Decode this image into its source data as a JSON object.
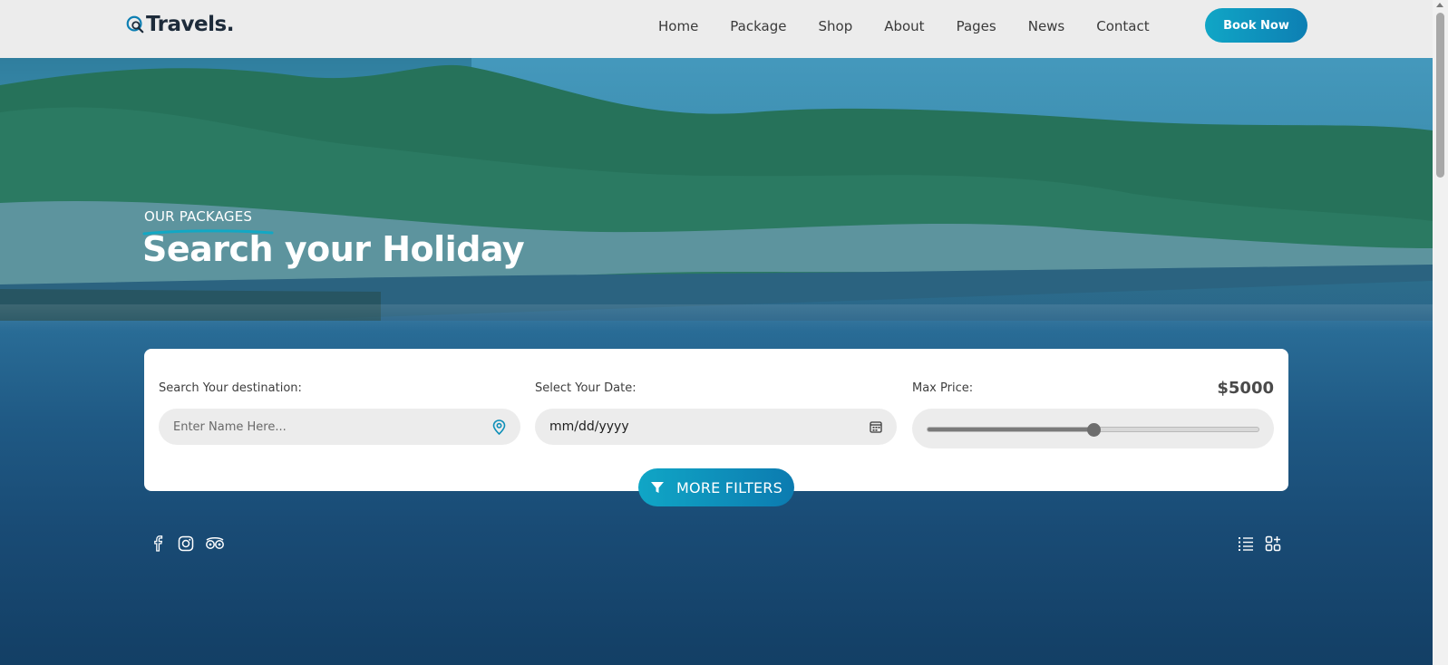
{
  "header": {
    "logo_text": "Travels.",
    "nav": [
      "Home",
      "Package",
      "Shop",
      "About",
      "Pages",
      "News",
      "Contact"
    ],
    "cta_label": "Book Now"
  },
  "hero": {
    "eyebrow": "OUR PACKAGES",
    "title_part1": "Search your ",
    "title_highlight": "Holiday"
  },
  "search": {
    "destination": {
      "label": "Search Your destination:",
      "placeholder": "Enter Name Here...",
      "icon": "location-pin-icon"
    },
    "date": {
      "label": "Select Your Date:",
      "value": "mm/dd/yyyy",
      "icon": "calendar-icon"
    },
    "price": {
      "label": "Max Price:",
      "value": "$5000",
      "slider_fraction": 0.5
    },
    "more_filters_label": "MORE FILTERS"
  },
  "social_icons": [
    "facebook-icon",
    "instagram-icon",
    "tripadvisor-icon"
  ],
  "view_icons": [
    "list-view-icon",
    "grid-view-icon"
  ],
  "colors": {
    "accent": "#10a6c6",
    "accent_dark": "#0c7bb0",
    "header_bg": "#ececec",
    "text_dark": "#1d2b3a"
  }
}
